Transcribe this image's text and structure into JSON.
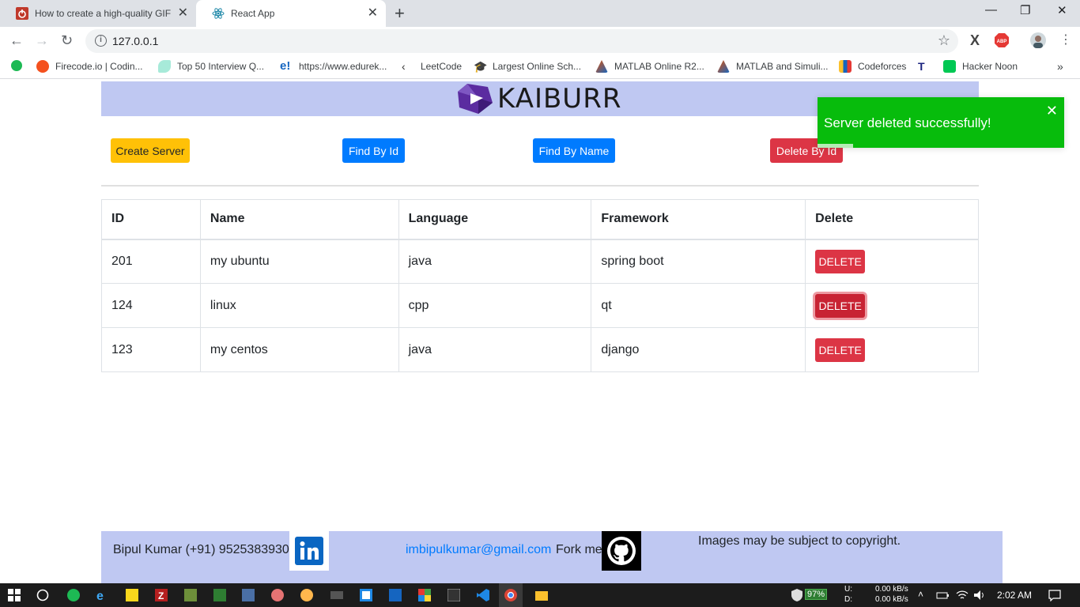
{
  "browser": {
    "tabs": [
      {
        "title": "How to create a high-quality GIF",
        "active": false
      },
      {
        "title": "React App",
        "active": true
      }
    ],
    "url": "127.0.0.1",
    "bookmarks": [
      "Firecode.io | Codin...",
      "Top 50 Interview Q...",
      "https://www.edurek...",
      "LeetCode",
      "Largest Online Sch...",
      "MATLAB Online R2...",
      "MATLAB and Simuli...",
      "Codeforces",
      "Hacker Noon"
    ],
    "more_bookmarks": "»"
  },
  "brand": {
    "logo_text": "KAIBURR",
    "logo_color": "#5b2ca0",
    "band_color": "#bfc8f2"
  },
  "actions": {
    "create": "Create Server",
    "find_id": "Find By Id",
    "find_name": "Find By Name",
    "delete_id": "Delete By Id"
  },
  "table": {
    "headers": [
      "ID",
      "Name",
      "Language",
      "Framework",
      "Delete"
    ],
    "rows": [
      {
        "id": "201",
        "name": "my ubuntu",
        "language": "java",
        "framework": "spring boot",
        "action": "DELETE"
      },
      {
        "id": "124",
        "name": "linux",
        "language": "cpp",
        "framework": "qt",
        "action": "DELETE"
      },
      {
        "id": "123",
        "name": "my centos",
        "language": "java",
        "framework": "django",
        "action": "DELETE"
      }
    ]
  },
  "toast": {
    "message": "Server deleted successfully!",
    "close": "✕",
    "color": "#07bc0c"
  },
  "footer": {
    "contact": "Bipul Kumar (+91) 9525383930",
    "email": "imbipulkumar@gmail.com",
    "fork": "Fork me",
    "copyright": "Images may be subject to copyright."
  },
  "taskbar": {
    "battery": "97%",
    "net_up_label": "U:",
    "net_down_label": "D:",
    "net_up": "0.00 kB/s",
    "net_down": "0.00 kB/s",
    "time": "2:02 AM"
  }
}
